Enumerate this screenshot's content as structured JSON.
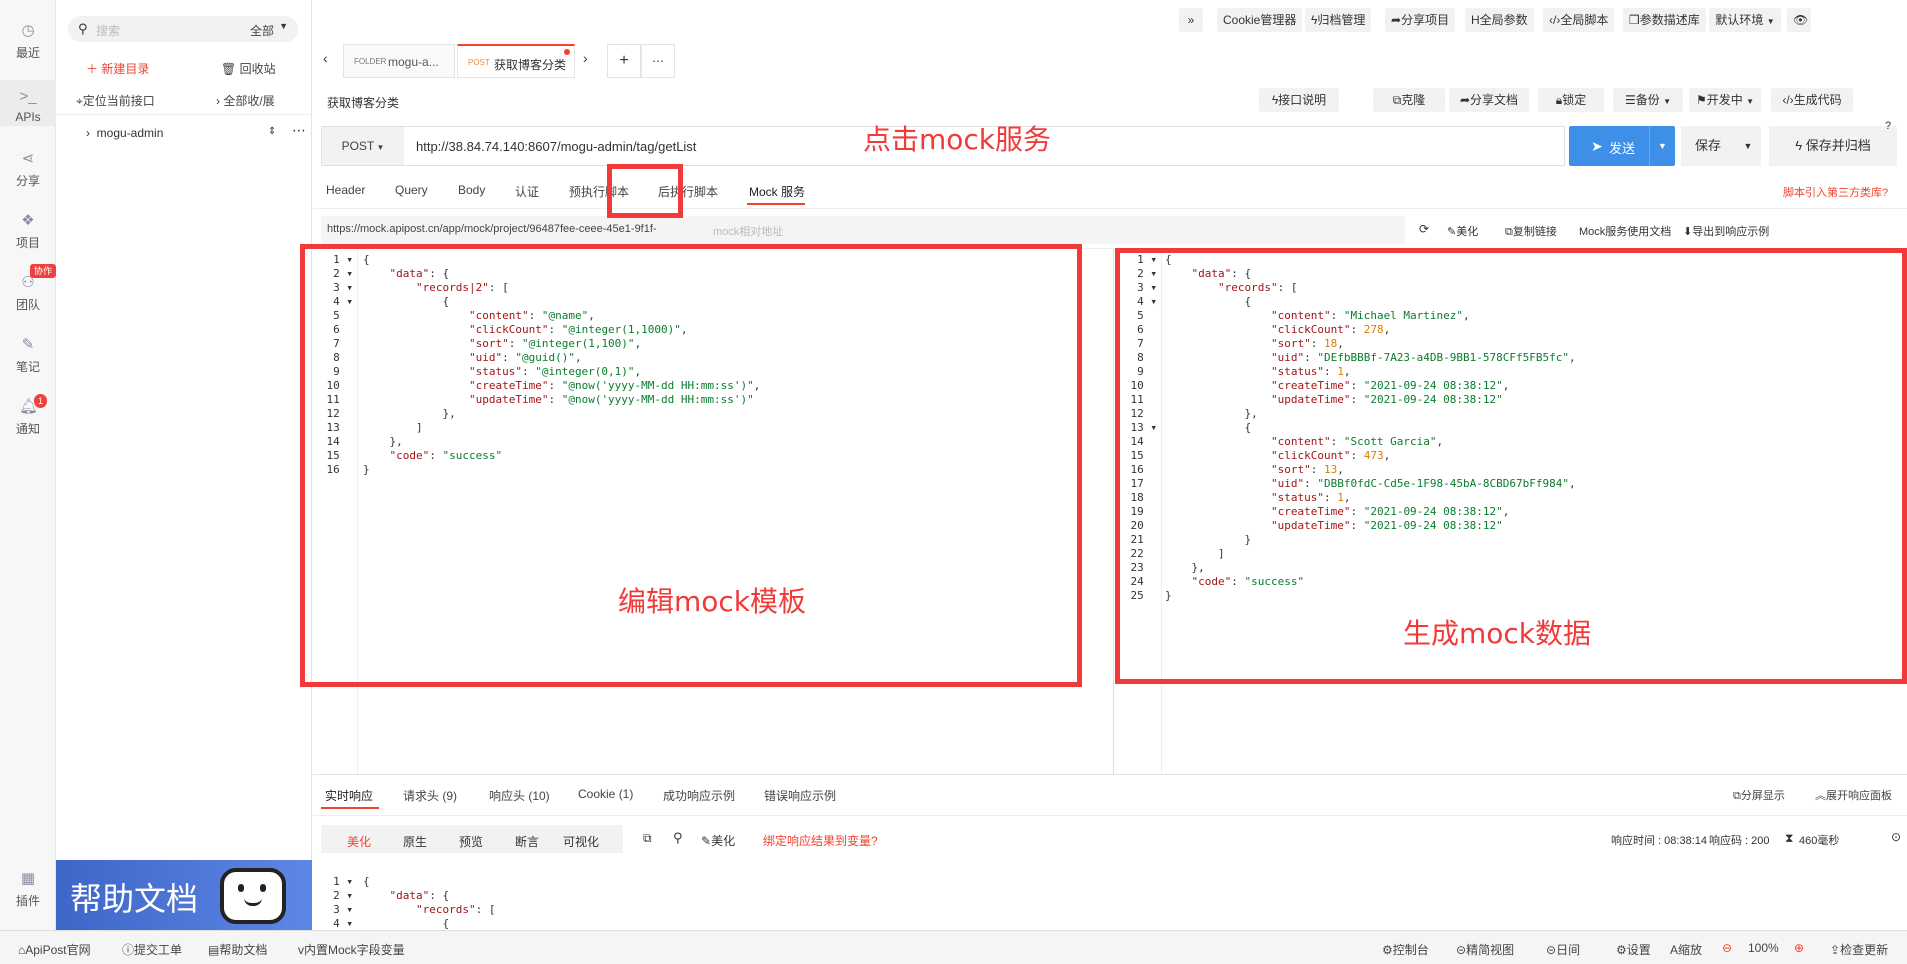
{
  "rail": {
    "items": [
      {
        "label": "最近",
        "icon": "clock-icon"
      },
      {
        "label": "APIs",
        "icon": "terminal-icon"
      },
      {
        "label": "分享",
        "icon": "share-icon"
      },
      {
        "label": "项目",
        "icon": "cubes-icon"
      },
      {
        "label": "团队",
        "icon": "team-icon",
        "badge": "协作"
      },
      {
        "label": "笔记",
        "icon": "note-icon"
      },
      {
        "label": "通知",
        "icon": "bell-icon",
        "badge": "1"
      },
      {
        "label": "插件",
        "icon": "grid-icon"
      }
    ]
  },
  "tree": {
    "search_placeholder": "搜索",
    "filter": "全部",
    "new_dir": "新建目录",
    "recycle": "回收站",
    "locate": "定位当前接口",
    "collapse": "全部收/展",
    "root": "mogu-admin"
  },
  "help_banner": "帮助文档",
  "topbar": [
    "»",
    "Cookie管理器",
    "归档管理",
    "分享项目",
    "全局参数",
    "全局脚本",
    "参数描述库",
    "默认环境"
  ],
  "tabs": [
    {
      "tag": "FOLDER",
      "label": "mogu-a..."
    },
    {
      "tag": "POST",
      "label": "获取博客分类"
    }
  ],
  "request": {
    "title": "获取博客分类",
    "actions": [
      "接口说明",
      "克隆",
      "分享文档",
      "锁定",
      "备份",
      "开发中",
      "生成代码"
    ],
    "method": "POST",
    "url": "http://38.84.74.140:8607/mogu-admin/tag/getList",
    "send": "发送",
    "save": "保存",
    "save_archive": "保存并归档",
    "sub_tabs": [
      "Header",
      "Query",
      "Body",
      "认证",
      "预执行脚本",
      "后执行脚本",
      "Mock 服务"
    ],
    "script_link": "脚本引入第三方类库?"
  },
  "mock": {
    "url": "https://mock.apipost.cn/app/mock/project/96487fee-ceee-45e1-9f1f-",
    "url_hint": "mock相对地址",
    "tools": [
      "美化",
      "复制链接",
      "Mock服务使用文档",
      "导出到响应示例"
    ]
  },
  "annotations": {
    "click_mock": "点击mock服务",
    "edit_template": "编辑mock模板",
    "gen_data": "生成mock数据"
  },
  "template_code": [
    "{",
    "    \"data\": {",
    "        \"records|2\": [",
    "            {",
    "                \"content\": \"@name\",",
    "                \"clickCount\": \"@integer(1,1000)\",",
    "                \"sort\": \"@integer(1,100)\",",
    "                \"uid\": \"@guid()\",",
    "                \"status\": \"@integer(0,1)\",",
    "                \"createTime\": \"@now('yyyy-MM-dd HH:mm:ss')\",",
    "                \"updateTime\": \"@now('yyyy-MM-dd HH:mm:ss')\"",
    "            },",
    "        ]",
    "    },",
    "    \"code\": \"success\"",
    "}"
  ],
  "generated_code": [
    "{",
    "    \"data\": {",
    "        \"records\": [",
    "            {",
    "                \"content\": \"Michael Martinez\",",
    "                \"clickCount\": 278,",
    "                \"sort\": 18,",
    "                \"uid\": \"DEfbBBBf-7A23-a4DB-9BB1-578CFf5FB5fc\",",
    "                \"status\": 1,",
    "                \"createTime\": \"2021-09-24 08:38:12\",",
    "                \"updateTime\": \"2021-09-24 08:38:12\"",
    "            },",
    "            {",
    "                \"content\": \"Scott Garcia\",",
    "                \"clickCount\": 473,",
    "                \"sort\": 13,",
    "                \"uid\": \"DBBf0fdC-Cd5e-1F98-45bA-8CBD67bFf984\",",
    "                \"status\": 1,",
    "                \"createTime\": \"2021-09-24 08:38:12\",",
    "                \"updateTime\": \"2021-09-24 08:38:12\"",
    "            }",
    "        ]",
    "    },",
    "    \"code\": \"success\"",
    "}"
  ],
  "response": {
    "tabs": [
      "实时响应",
      "请求头 (9)",
      "响应头 (10)",
      "Cookie (1)",
      "成功响应示例",
      "错误响应示例"
    ],
    "split": "分屏显示",
    "expand": "展开响应面板",
    "views": [
      "美化",
      "原生",
      "预览",
      "断言",
      "可视化"
    ],
    "beautify": "美化",
    "bind": "绑定响应结果到变量?",
    "time_label": "响应时间 : 08:38:14",
    "code_label": "响应码 : 200",
    "ms": "460毫秒",
    "code": [
      "{",
      "    \"data\": {",
      "        \"records\": [",
      "            {"
    ]
  },
  "statusbar": {
    "left": [
      "ApiPost官网",
      "提交工单",
      "帮助文档",
      "内置Mock字段变量"
    ],
    "right": [
      "控制台",
      "精简视图",
      "日间",
      "设置",
      "缩放",
      "100%",
      "检查更新"
    ]
  }
}
